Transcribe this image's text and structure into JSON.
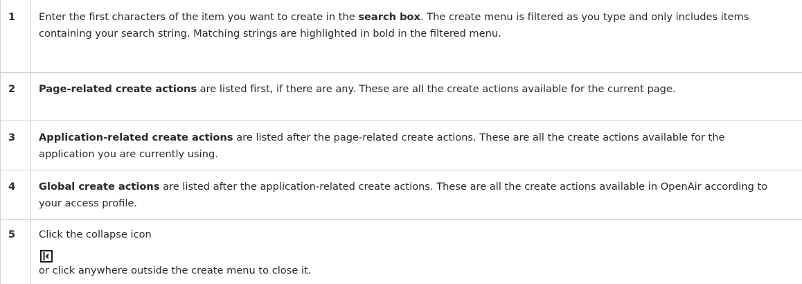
{
  "rows": [
    {
      "number": "1",
      "text_a": "Enter the first characters of the item you want to create in the ",
      "bold": "search box",
      "text_b": ". The create menu is filtered as you type and only includes items containing your search string. Matching strings are highlighted in bold in the filtered menu."
    },
    {
      "number": "2",
      "bold": "Page-related create actions",
      "text_b": " are listed first, if there are any. These are all the create actions available for the current page."
    },
    {
      "number": "3",
      "bold": "Application-related create actions",
      "text_b": " are listed after the page-related create actions. These are all the create actions available for the application you are currently using."
    },
    {
      "number": "4",
      "bold": "Global create actions",
      "text_b": " are listed after the application-related create actions. These are all the create actions available in OpenAir according to your access profile."
    },
    {
      "number": "5",
      "text_a": "Click the collapse icon ",
      "icon": "collapse-icon",
      "text_b": " or click anywhere outside the create menu to close it."
    }
  ]
}
